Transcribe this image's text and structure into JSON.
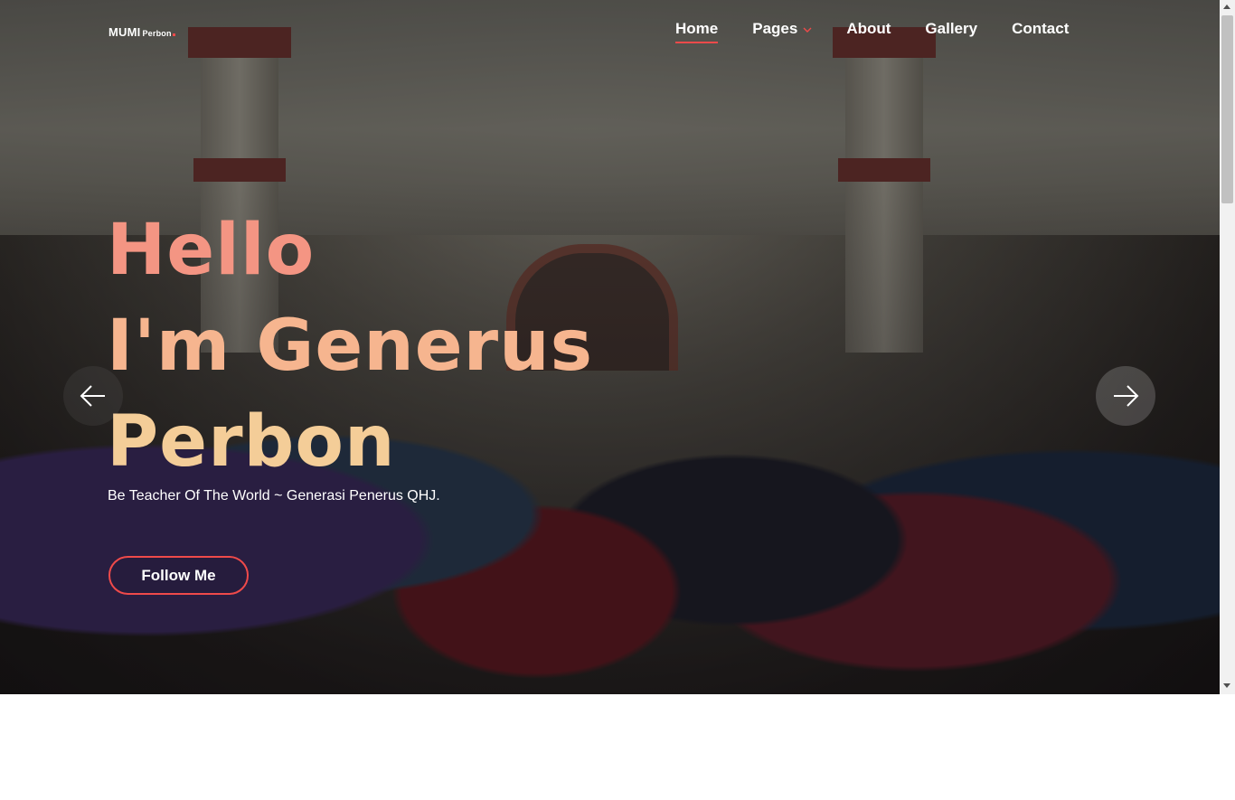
{
  "brand": {
    "name_main": "MUMI",
    "name_small": "Perbon"
  },
  "nav": {
    "items": [
      {
        "label": "Home",
        "active": true
      },
      {
        "label": "Pages",
        "active": false,
        "has_dropdown": true
      },
      {
        "label": "About",
        "active": false
      },
      {
        "label": "Gallery",
        "active": false
      },
      {
        "label": "Contact",
        "active": false
      }
    ]
  },
  "hero": {
    "headline_line1": "Hello",
    "headline_line2": "I'm Generus",
    "headline_line3": "Perbon",
    "subtitle": "Be Teacher Of The World ~ Generasi Penerus QHJ.",
    "cta_label": "Follow Me"
  },
  "icons": {
    "prev": "arrow-left-icon",
    "next": "arrow-right-icon",
    "dropdown": "chevron-down-icon"
  },
  "colors": {
    "accent": "#ef4a4a",
    "headline_1": "#f49583",
    "headline_2": "#f6b58f",
    "headline_3": "#f4cd98"
  }
}
